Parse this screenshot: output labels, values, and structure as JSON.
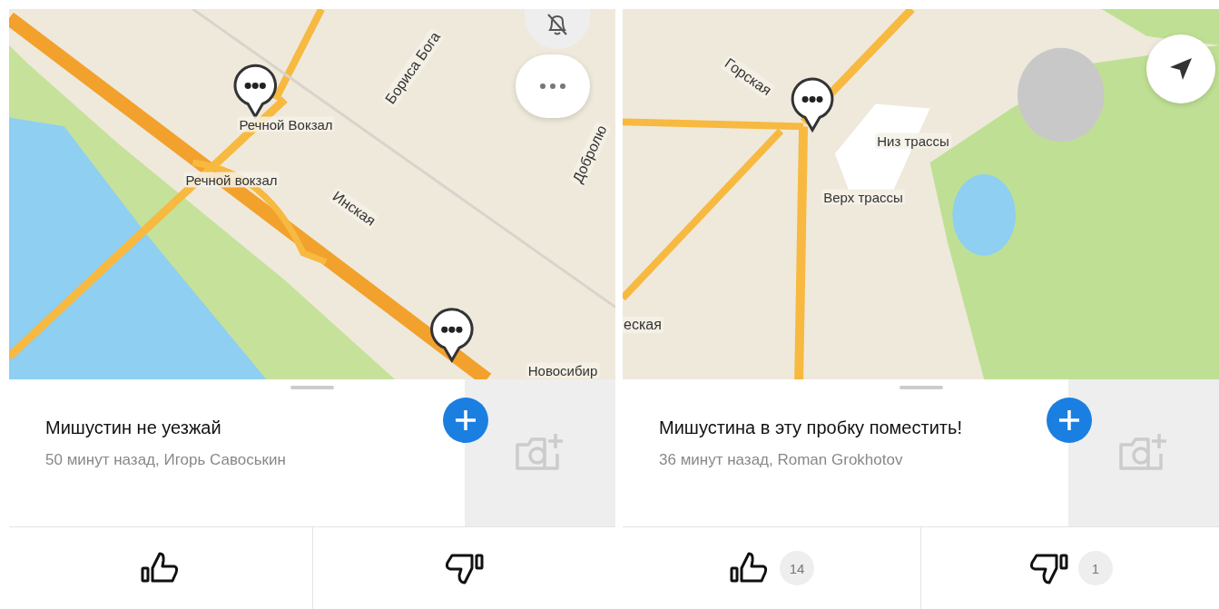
{
  "panels": [
    {
      "map": {
        "labels": [
          {
            "text": "Бориса Бога",
            "kind": "street"
          },
          {
            "text": "Речной Вокзал",
            "kind": "place"
          },
          {
            "text": "Речной вокзал",
            "kind": "place"
          },
          {
            "text": "Инская",
            "kind": "street"
          },
          {
            "text": "Добролю",
            "kind": "street"
          },
          {
            "text": "Новосибир",
            "kind": "place"
          }
        ],
        "buttons": [
          {
            "kind": "mute"
          },
          {
            "kind": "more"
          }
        ]
      },
      "post": {
        "title": "Мишустин не уезжай",
        "meta": "50 минут назад, Игорь Савоськин"
      }
    },
    {
      "map": {
        "labels": [
          {
            "text": "Горская",
            "kind": "street"
          },
          {
            "text": "Низ трассы",
            "kind": "place"
          },
          {
            "text": "Верх трассы",
            "kind": "place"
          },
          {
            "text": "еская",
            "kind": "street"
          }
        ],
        "buttons": [
          {
            "kind": "locate"
          }
        ]
      },
      "post": {
        "title": "Мишустина в эту пробку поместить!",
        "meta": "36 минут назад, Roman Grokhotov"
      },
      "rating": {
        "likes": {
          "count": "14"
        },
        "dislikes": {
          "count": "1"
        }
      }
    }
  ]
}
